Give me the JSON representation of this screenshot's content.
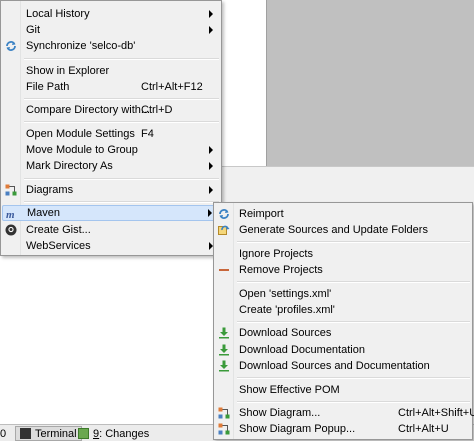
{
  "colors": {
    "menu_bg": "#f0f0f0",
    "highlight": "#d5e6fb",
    "highlight_border": "#a4c5ee",
    "editor_gray": "#c0c0c0",
    "maven_blue": "#3b82c4",
    "download_green": "#3a9a3a",
    "remove_orange": "#c8663a"
  },
  "context_menu": {
    "local_history": "Local History",
    "git": "Git",
    "synchronize": "Synchronize 'selco-db'",
    "show_in_explorer": "Show in Explorer",
    "file_path": "File Path",
    "file_path_shortcut": "Ctrl+Alt+F12",
    "compare_directory": "Compare Directory with...",
    "compare_directory_shortcut": "Ctrl+D",
    "open_module_settings": "Open Module Settings",
    "open_module_settings_shortcut": "F4",
    "move_module": "Move Module to Group",
    "mark_directory": "Mark Directory As",
    "diagrams": "Diagrams",
    "maven": "Maven",
    "create_gist": "Create Gist...",
    "webservices": "WebServices",
    "icons": {
      "synchronize": "sync-icon",
      "diagrams": "diagram-icon",
      "maven": "maven-icon",
      "create_gist": "github-icon"
    }
  },
  "maven_menu": {
    "reimport": "Reimport",
    "generate_sources": "Generate Sources and Update Folders",
    "ignore_projects": "Ignore Projects",
    "remove_projects": "Remove Projects",
    "open_settings": "Open 'settings.xml'",
    "create_profiles": "Create 'profiles.xml'",
    "download_sources": "Download Sources",
    "download_documentation": "Download Documentation",
    "download_both": "Download Sources and Documentation",
    "show_effective_pom": "Show Effective POM",
    "show_diagram": "Show Diagram...",
    "show_diagram_shortcut": "Ctrl+Alt+Shift+U",
    "show_diagram_popup": "Show Diagram Popup...",
    "show_diagram_popup_shortcut": "Ctrl+Alt+U",
    "icons": {
      "reimport": "reimport-icon",
      "generate_sources": "generate-sources-icon",
      "remove_projects": "remove-icon",
      "download": "download-icon",
      "show_diagram": "diagram-icon"
    }
  },
  "statusbar": {
    "left_fragment": "0",
    "terminal": "Terminal",
    "changes_key": "9",
    "changes_rest": ": Changes"
  }
}
